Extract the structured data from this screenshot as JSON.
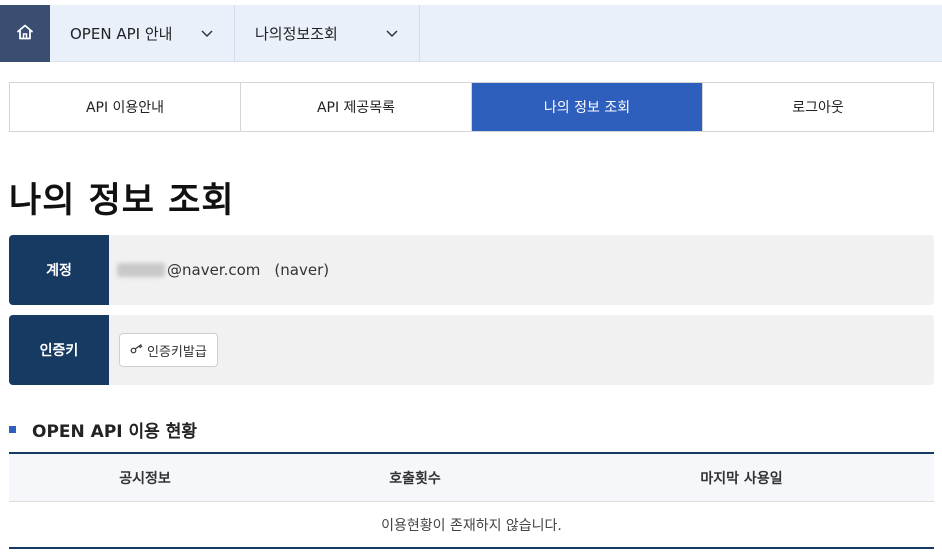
{
  "topnav": {
    "home_icon": "home-icon",
    "crumbs": [
      {
        "label": "OPEN API 안내"
      },
      {
        "label": "나의정보조회"
      }
    ]
  },
  "tabs": [
    {
      "label": "API 이용안내",
      "active": false
    },
    {
      "label": "API 제공목록",
      "active": false
    },
    {
      "label": "나의 정보 조회",
      "active": true
    },
    {
      "label": "로그아웃",
      "active": false
    }
  ],
  "page": {
    "title": "나의 정보 조회"
  },
  "account": {
    "label": "계정",
    "email_domain": "@naver.com",
    "provider": "(naver)"
  },
  "auth_key": {
    "label": "인증키",
    "button_icon": "key-icon",
    "button_label": "인증키발급"
  },
  "usage": {
    "section_title": "OPEN API 이용 현황",
    "columns": [
      "공시정보",
      "호출횟수",
      "마지막 사용일"
    ],
    "empty_message": "이용현황이 존재하지 않습니다."
  },
  "colors": {
    "accent": "#2f5fbd",
    "navy": "#173a63",
    "home_bg": "#3a4e72",
    "nav_bg": "#e9f0fa"
  }
}
